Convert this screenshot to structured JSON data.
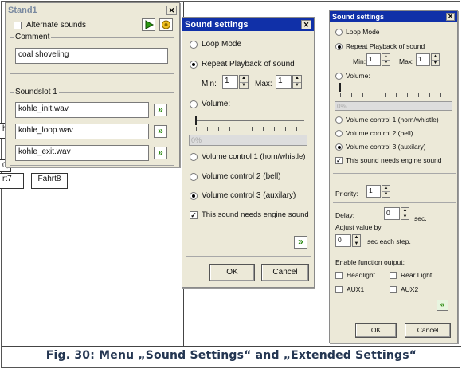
{
  "caption": "Fig. 30: Menu „Sound Settings“ and „Extended Settings“",
  "background_fragments": [
    "hc",
    "0,",
    "rt7",
    "Fahrt8"
  ],
  "stand_window": {
    "title": "Stand1",
    "alternate_sounds": "Alternate sounds",
    "comment_group": "Comment",
    "comment_value": "coal shoveling",
    "soundslot_group": "Soundslot 1",
    "slots": [
      "kohle_init.wav",
      "kohle_loop.wav",
      "kohle_exit.wav"
    ]
  },
  "sound_settings": {
    "title": "Sound settings",
    "loop_mode": "Loop Mode",
    "repeat_playback": "Repeat Playback of sound",
    "min_label": "Min:",
    "min_value": "1",
    "max_label": "Max:",
    "max_value": "1",
    "volume": "Volume:",
    "volume_percent": "0%",
    "vc1": "Volume control  1 (horn/whistle)",
    "vc2": "Volume control 2 (bell)",
    "vc3": "Volume control 3 (auxilary)",
    "engine": "This sound needs engine sound",
    "ok": "OK",
    "cancel": "Cancel"
  },
  "extended_settings": {
    "title": "Sound settings",
    "loop_mode": "Loop Mode",
    "repeat_playback": "Repeat Playback of sound",
    "min_label": "Min:",
    "min_value": "1",
    "max_label": "Max:",
    "max_value": "1",
    "volume": "Volume:",
    "volume_percent": "0%",
    "vc1": "Volume control 1 (horn/whistle)",
    "vc2": "Volume control 2 (bell)",
    "vc3": "Volume control 3 (auxilary)",
    "engine": "This sound needs engine sound",
    "priority_label": "Priority:",
    "priority_value": "1",
    "delay_label": "Delay:",
    "delay_value": "0",
    "delay_unit": "sec.",
    "adjust_label": "Adjust value by",
    "adjust_value": "0",
    "adjust_unit": "sec each step.",
    "enable_output": "Enable function output:",
    "headlight": "Headlight",
    "rear_light": "Rear Light",
    "aux1": "AUX1",
    "aux2": "AUX2",
    "ok": "OK",
    "cancel": "Cancel"
  }
}
